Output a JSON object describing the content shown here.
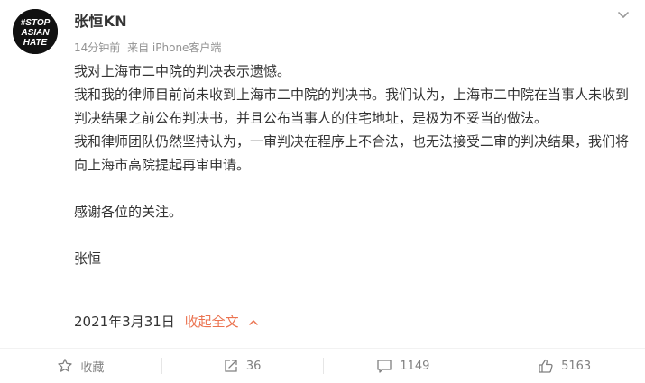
{
  "post": {
    "author": "张恒KN",
    "avatar_text": [
      "#STOP",
      "ASIAN",
      "HATE"
    ],
    "time": "14分钟前",
    "source": "来自 iPhone客户端",
    "content": {
      "line1": "我对上海市二中院的判决表示遗憾。",
      "para2": "我和我的律师目前尚未收到上海市二中院的判决书。我们认为，上海市二中院在当事人未收到判决结果之前公布判决书，并且公布当事人的住宅地址，是极为不妥当的做法。",
      "para3": "我和律师团队仍然坚持认为，一审判决在程序上不合法，也无法接受二审的判决结果，我们将向上海市高院提起再审申请。",
      "para4": "感谢各位的关注。",
      "signature": "张恒"
    },
    "date": "2021年3月31日",
    "collapse_label": "收起全文"
  },
  "actions": {
    "favorite_label": "收藏",
    "repost_count": "36",
    "comment_count": "1149",
    "like_count": "5163"
  },
  "colors": {
    "accent": "#eb7350",
    "text": "#333333",
    "muted": "#939393",
    "icon": "#808080"
  },
  "icons": [
    "dropdown-chevron-icon",
    "star-icon",
    "repost-icon",
    "comment-icon",
    "like-icon",
    "chevron-up-icon"
  ]
}
